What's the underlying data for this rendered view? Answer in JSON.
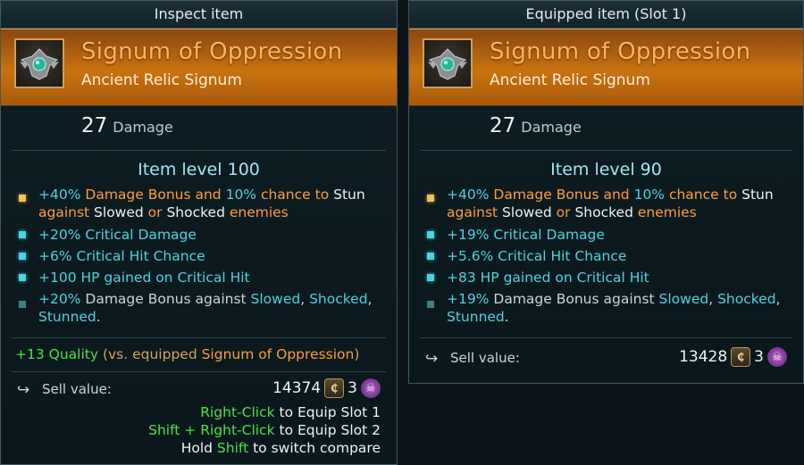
{
  "left": {
    "title": "Inspect item",
    "item_name": "Signum of Oppression",
    "item_type": "Ancient Relic Signum",
    "damage_value": "27",
    "damage_label": "Damage",
    "item_level": "Item level 100",
    "affix1": {
      "a": "+40%",
      "b": " Damage Bonus and ",
      "c": "10%",
      "d": " chance to ",
      "e": "Stun",
      "f": "against ",
      "g": "Slowed",
      "h": " or ",
      "i": "Shocked",
      "j": " enemies"
    },
    "affix2": {
      "value": "+20%",
      "text": " Critical Damage"
    },
    "affix3": {
      "value": "+6%",
      "text": " Critical Hit Chance"
    },
    "affix4": {
      "value": "+100",
      "text": " HP gained on Critical Hit"
    },
    "affix5": {
      "value": "+20%",
      "text": " Damage Bonus against ",
      "s1": "Slowed",
      "sep1": ", ",
      "s2": "Shocked",
      "sep2": ",",
      "s3": "Stunned",
      "end": "."
    },
    "quality": {
      "value": "+13 Quality",
      "pre": " (vs. equipped ",
      "ref": "Signum of Oppression",
      "post": ")"
    },
    "sell_label": "Sell value:",
    "sell_value": "14374",
    "shard_count": "3",
    "hint1": {
      "key": "Right-Click",
      "text": " to Equip Slot 1"
    },
    "hint2": {
      "key": "Shift + Right-Click",
      "text": " to Equip Slot 2"
    },
    "hint3": {
      "pre": "Hold ",
      "key": "Shift",
      "text": " to switch compare"
    }
  },
  "right": {
    "title": "Equipped item (Slot 1)",
    "item_name": "Signum of Oppression",
    "item_type": "Ancient Relic Signum",
    "damage_value": "27",
    "damage_label": "Damage",
    "item_level": "Item level 90",
    "affix1": {
      "a": "+40%",
      "b": " Damage Bonus and ",
      "c": "10%",
      "d": " chance to ",
      "e": "Stun",
      "f": "against ",
      "g": "Slowed",
      "h": " or ",
      "i": "Shocked",
      "j": " enemies"
    },
    "affix2": {
      "value": "+19%",
      "text": " Critical Damage"
    },
    "affix3": {
      "value": "+5.6%",
      "text": " Critical Hit Chance"
    },
    "affix4": {
      "value": "+83",
      "text": " HP gained on Critical Hit"
    },
    "affix5": {
      "value": "+19%",
      "text": " Damage Bonus against ",
      "s1": "Slowed",
      "sep1": ", ",
      "s2": "Shocked",
      "sep2": ",",
      "s3": "Stunned",
      "end": "."
    },
    "sell_label": "Sell value:",
    "sell_value": "13428",
    "shard_count": "3"
  },
  "icons": {
    "sell": "share-arrow-icon",
    "coin": "credit-coin-icon",
    "shard": "skull-shard-icon",
    "relic": "relic-signum-icon"
  },
  "colors": {
    "header": "#c9720f",
    "item_name": "#ffb35c",
    "affix_blue": "#4fd2e0",
    "affix_orange": "#ff9d3a",
    "quality_green": "#4ee04a"
  }
}
